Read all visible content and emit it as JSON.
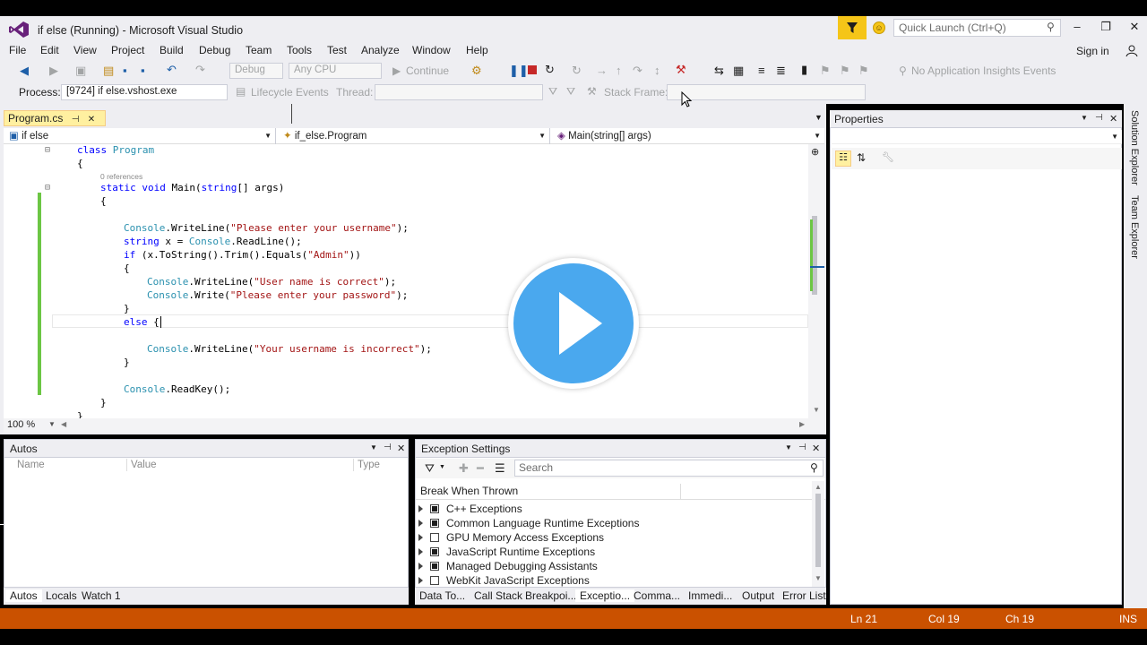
{
  "title": {
    "window_title": "if else (Running) - Microsoft Visual Studio",
    "quick_launch_placeholder": "Quick Launch (Ctrl+Q)",
    "sign_in": "Sign in"
  },
  "menu": [
    "File",
    "Edit",
    "View",
    "Project",
    "Build",
    "Debug",
    "Team",
    "Tools",
    "Test",
    "Analyze",
    "Window",
    "Help"
  ],
  "toolbar": {
    "config": "Debug",
    "platform": "Any CPU",
    "continue": "Continue",
    "app_insights": "No Application Insights Events",
    "process_label": "Process:",
    "process_value": "[9724] if else.vshost.exe",
    "lifecycle": "Lifecycle Events",
    "thread_label": "Thread:",
    "stack_frame": "Stack Frame:"
  },
  "editor": {
    "tab_label": "Program.cs",
    "nav_project": "if else",
    "nav_class": "if_else.Program",
    "nav_member": "Main(string[] args)",
    "zoom": "100 %",
    "references": "0 references"
  },
  "code": {
    "l1_kw": "class",
    "l1_type": "Program",
    "l2": "{",
    "l3_kw": "static void",
    "l3_rest": " Main(",
    "l3_kw2": "string",
    "l3_rest2": "[] args)",
    "l4": "{",
    "l5_type": "Console",
    "l5_mid": ".WriteLine(",
    "l5_str": "\"Please enter your username\"",
    "l5_end": ");",
    "l6_kw": "string",
    "l6_mid": " x = ",
    "l6_type": "Console",
    "l6_end": ".ReadLine();",
    "l7_kw": "if",
    "l7_mid": " (x.ToString().Trim().Equals(",
    "l7_str": "\"Admin\"",
    "l7_end": "))",
    "l8": "{",
    "l9_type": "Console",
    "l9_mid": ".WriteLine(",
    "l9_str": "\"User name is correct\"",
    "l9_end": ");",
    "l10_type": "Console",
    "l10_mid": ".Write(",
    "l10_str": "\"Please enter your password\"",
    "l10_end": ");",
    "l11": "}",
    "l12_kw": "else",
    "l12_end": " {",
    "l13_type": "Console",
    "l13_mid": ".WriteLine(",
    "l13_str": "\"Your username is incorrect\"",
    "l13_end": ");",
    "l14": "}",
    "l15_type": "Console",
    "l15_end": ".ReadKey();",
    "l16": "}",
    "l17": "}"
  },
  "properties": {
    "title": "Properties"
  },
  "right_rail": {
    "solution_explorer": "Solution Explorer",
    "team_explorer": "Team Explorer"
  },
  "autos": {
    "title": "Autos",
    "columns": [
      "Name",
      "Value",
      "Type"
    ],
    "tabs": [
      "Autos",
      "Locals",
      "Watch 1"
    ]
  },
  "exceptions": {
    "title": "Exception Settings",
    "search_placeholder": "Search",
    "column": "Break When Thrown",
    "rows": [
      {
        "label": "C++ Exceptions",
        "checked": true
      },
      {
        "label": "Common Language Runtime Exceptions",
        "checked": true
      },
      {
        "label": "GPU Memory Access Exceptions",
        "checked": false
      },
      {
        "label": "JavaScript Runtime Exceptions",
        "checked": true
      },
      {
        "label": "Managed Debugging Assistants",
        "checked": true
      },
      {
        "label": "WebKit JavaScript Exceptions",
        "checked": false
      }
    ],
    "tabs": [
      "Data To...",
      "Call Stack",
      "Breakpoi...",
      "Exceptio...",
      "Comma...",
      "Immedi...",
      "Output",
      "Error List"
    ]
  },
  "statusbar": {
    "line": "Ln 21",
    "col": "Col 19",
    "ch": "Ch 19",
    "mode": "INS"
  },
  "colors": {
    "statusbar": "#ca5100",
    "accent_play": "#4aa8ee",
    "chrome": "#eeeef2"
  }
}
